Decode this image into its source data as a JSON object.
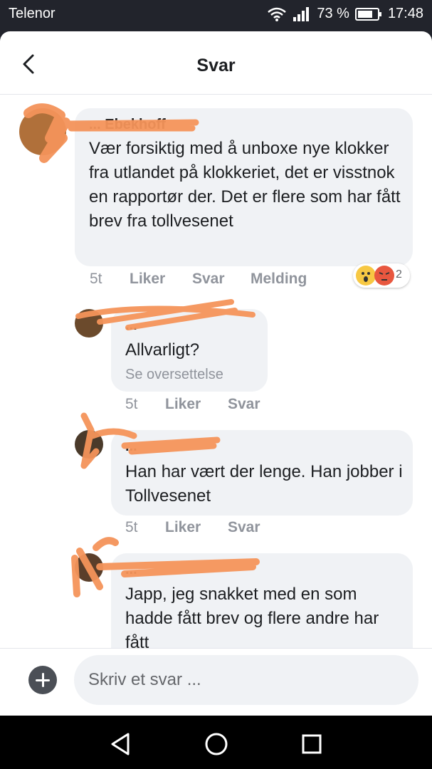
{
  "status_bar": {
    "carrier": "Telenor",
    "battery": "73 %",
    "time": "17:48"
  },
  "header": {
    "title": "Svar"
  },
  "comments": [
    {
      "name": "... Ebekhoff",
      "text": "Vær forsiktig med å unboxe nye klokker fra utlandet på klokkeriet, det er visstnok en rapportør der. Det er flere som har fått brev fra tollvesenet",
      "time": "5t",
      "like": "Liker",
      "reply": "Svar",
      "message": "Melding",
      "reaction_count": "2"
    },
    {
      "name": "...",
      "text": "Allvarligt?",
      "translate": "Se oversettelse",
      "time": "5t",
      "like": "Liker",
      "reply": "Svar"
    },
    {
      "name": "...",
      "text": "Han har vært der lenge. Han jobber i Tollvesenet",
      "time": "5t",
      "like": "Liker",
      "reply": "Svar"
    },
    {
      "name": "...",
      "text": "Japp, jeg snakket med en som hadde fått brev og flere andre har fått"
    }
  ],
  "composer": {
    "placeholder": "Skriv et svar ..."
  },
  "colors": {
    "redaction": "#f4935a",
    "bubble": "#f0f2f5",
    "meta": "#90949c"
  }
}
